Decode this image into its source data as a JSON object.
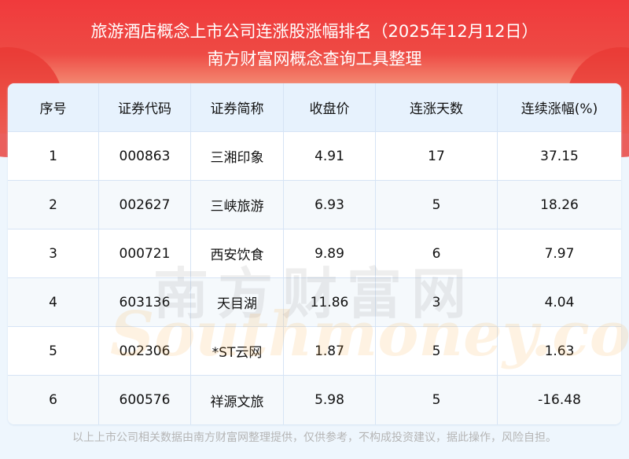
{
  "header": {
    "title": "旅游酒店概念上市公司连涨股涨幅排名（2025年12月12日）",
    "subtitle": "南方财富网概念查询工具整理"
  },
  "table": {
    "columns": [
      "序号",
      "证券代码",
      "证券简称",
      "收盘价",
      "连涨天数",
      "连续涨幅(%)"
    ],
    "rows": [
      [
        "1",
        "000863",
        "三湘印象",
        "4.91",
        "17",
        "37.15"
      ],
      [
        "2",
        "002627",
        "三峡旅游",
        "6.93",
        "5",
        "18.26"
      ],
      [
        "3",
        "000721",
        "西安饮食",
        "9.89",
        "6",
        "7.97"
      ],
      [
        "4",
        "603136",
        "天目湖",
        "11.86",
        "3",
        "4.04"
      ],
      [
        "5",
        "002306",
        "*ST云网",
        "1.87",
        "5",
        "1.63"
      ],
      [
        "6",
        "600576",
        "祥源文旅",
        "5.98",
        "5",
        "-16.48"
      ]
    ]
  },
  "watermark": {
    "cn": "南方财富网",
    "en": "Southmoney.com"
  },
  "footer": "以上上市公司相关数据由南方财富网整理提供，仅供参考，不构成投资建议，据此操作，风险自担。"
}
